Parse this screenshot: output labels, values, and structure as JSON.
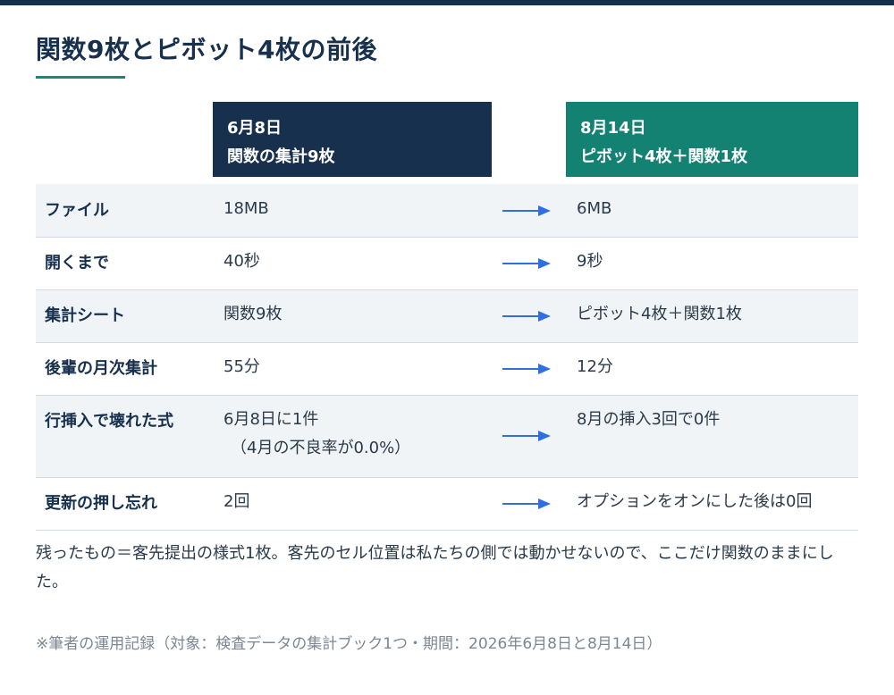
{
  "title": "関数9枚とピボット4枚の前後",
  "columns": {
    "before": {
      "date": "6月8日",
      "desc": "関数の集計9枚"
    },
    "after": {
      "date": "8月14日",
      "desc": "ピボット4枚＋関数1枚"
    }
  },
  "rows": [
    {
      "label": "ファイル",
      "before": [
        "18MB"
      ],
      "after": [
        "6MB"
      ]
    },
    {
      "label": "開くまで",
      "before": [
        "40秒"
      ],
      "after": [
        "9秒"
      ]
    },
    {
      "label": "集計シート",
      "before": [
        "関数9枚"
      ],
      "after": [
        "ピボット4枚＋関数1枚"
      ]
    },
    {
      "label": "後輩の月次集計",
      "before": [
        "55分"
      ],
      "after": [
        "12分"
      ]
    },
    {
      "label": "行挿入で壊れた式",
      "before": [
        "6月8日に1件",
        "（4月の不良率が0.0%）"
      ],
      "after": [
        "8月の挿入3回で0件"
      ]
    },
    {
      "label": "更新の押し忘れ",
      "before": [
        "2回"
      ],
      "after": [
        "オプションをオンにした後は0回"
      ]
    }
  ],
  "note": "残ったもの＝客先提出の様式1枚。客先のセル位置は私たちの側では動かせないので、ここだけ関数のままにした。",
  "footnote": "※筆者の運用記録（対象：検査データの集計ブック1つ・期間：2026年6月8日と8月14日）",
  "colors": {
    "navy": "#17304d",
    "teal": "#138273",
    "arrow": "#2f6fe0",
    "row_shade": "#f0f4f7"
  }
}
